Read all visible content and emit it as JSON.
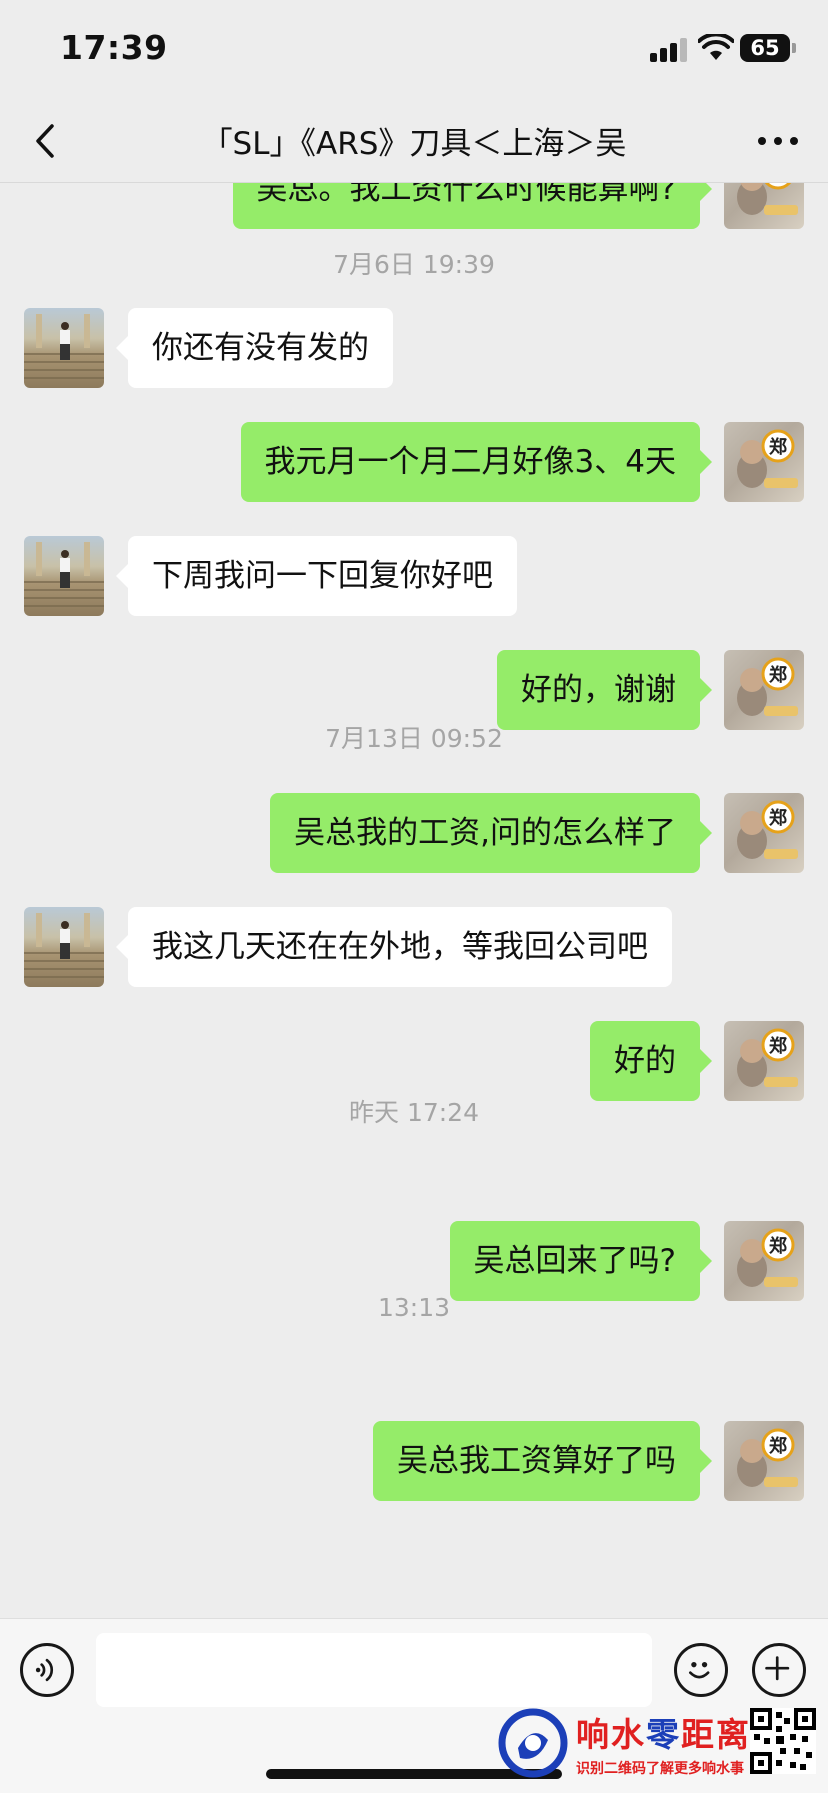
{
  "status_bar": {
    "time": "17:39",
    "battery": "65"
  },
  "nav": {
    "title": "「SL」《ARS》刀具＜上海＞吴"
  },
  "messages": [
    {
      "type": "out",
      "text": "吴总。我工资什么时候能算啊?"
    },
    {
      "type": "time",
      "text": "7月6日 19:39"
    },
    {
      "type": "in",
      "text": "你还有没有发的"
    },
    {
      "type": "out",
      "text": "我元月一个月二月好像3、4天"
    },
    {
      "type": "in",
      "text": "下周我问一下回复你好吧"
    },
    {
      "type": "out",
      "text": "好的，谢谢"
    },
    {
      "type": "time",
      "text": "7月13日 09:52"
    },
    {
      "type": "out",
      "text": "吴总我的工资,问的怎么样了"
    },
    {
      "type": "in",
      "text": "我这几天还在在外地，等我回公司吧"
    },
    {
      "type": "out",
      "text": "好的"
    },
    {
      "type": "time",
      "text": "昨天 17:24"
    },
    {
      "type": "out",
      "text": "吴总回来了吗?"
    },
    {
      "type": "time",
      "text": "13:13"
    },
    {
      "type": "out",
      "text": "吴总我工资算好了吗"
    }
  ],
  "avatar_badge": "郑",
  "watermark": {
    "title_red": "响水",
    "title_blue": "零",
    "title_red2": "距离",
    "subtitle": "识别二维码了解更多响水事"
  },
  "colors": {
    "outgoing_bubble": "#95ec69",
    "incoming_bubble": "#ffffff",
    "background": "#ededed"
  }
}
